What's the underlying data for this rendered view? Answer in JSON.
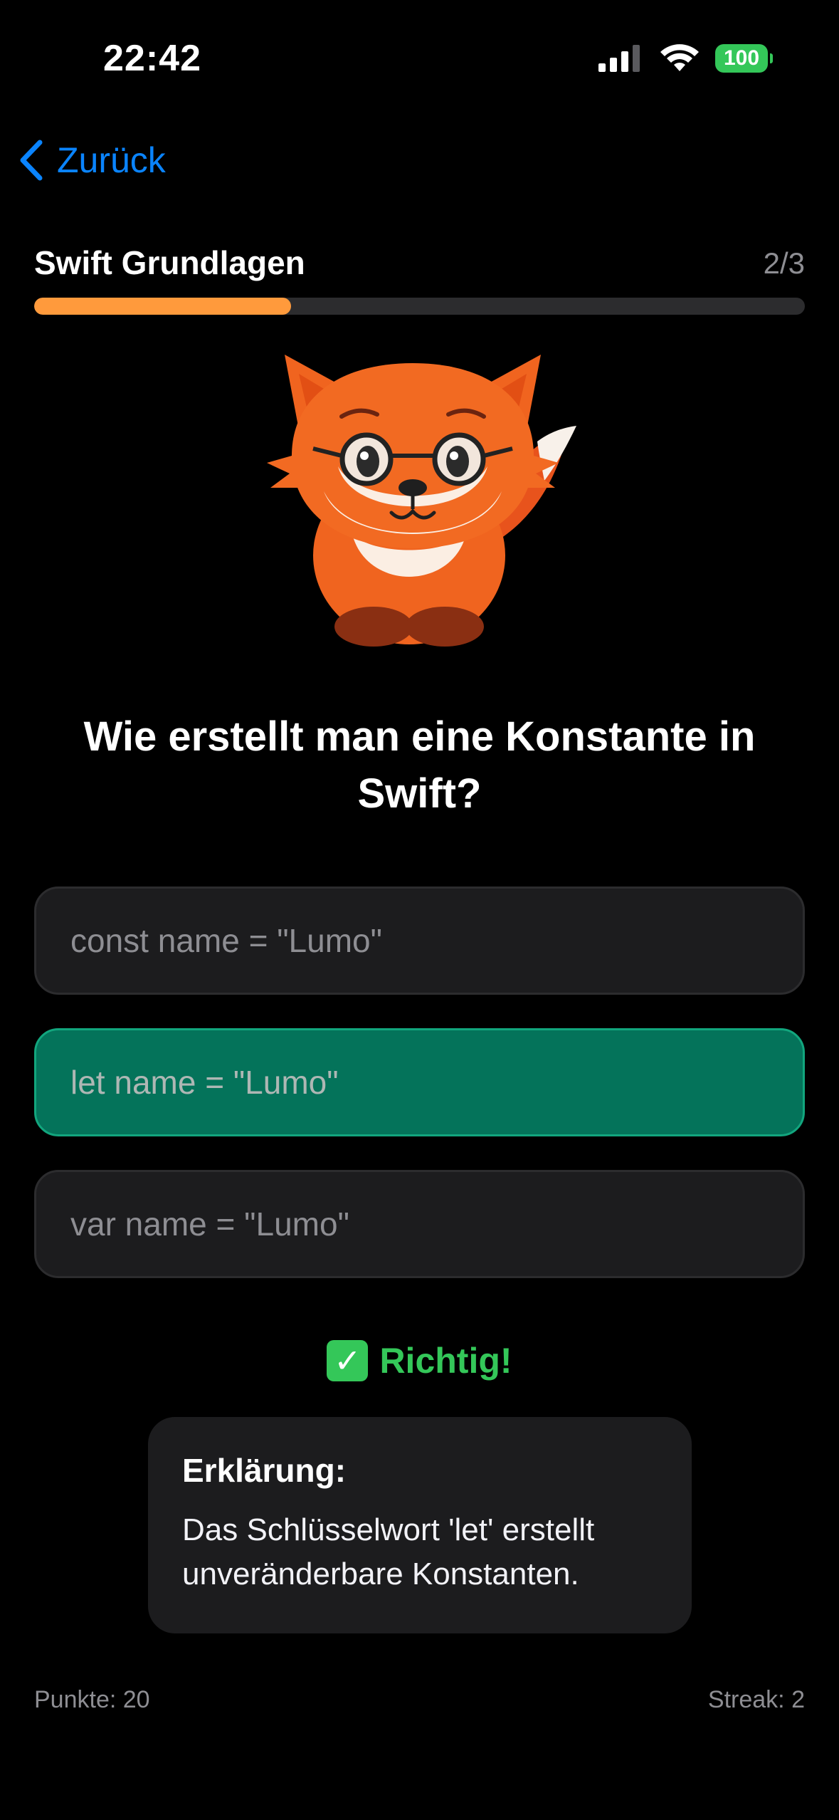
{
  "status_bar": {
    "time": "22:42",
    "battery": "100"
  },
  "nav": {
    "back_label": "Zurück"
  },
  "lesson": {
    "title": "Swift Grundlagen",
    "counter": "2/3",
    "progress": 0.333
  },
  "mascot": {
    "name": "fox-mascot"
  },
  "question": "Wie erstellt man eine Konstante in Swift?",
  "answers": [
    {
      "label": "const name = \"Lumo\""
    },
    {
      "label": "let name = \"Lumo\""
    },
    {
      "label": "var name = \"Lumo\""
    }
  ],
  "feedback": {
    "icon": "✓",
    "text": "Richtig!"
  },
  "explanation": {
    "title": "Erklärung:",
    "body": "Das Schlüsselwort 'let' erstellt unveränderbare Konstanten."
  },
  "footer": {
    "points": "Punkte: 20",
    "streak": "Streak: 2"
  },
  "colors": {
    "accent": "#0a84ff",
    "progress": "#ff9a3c",
    "correct": "#04735a",
    "success": "#34c759"
  }
}
